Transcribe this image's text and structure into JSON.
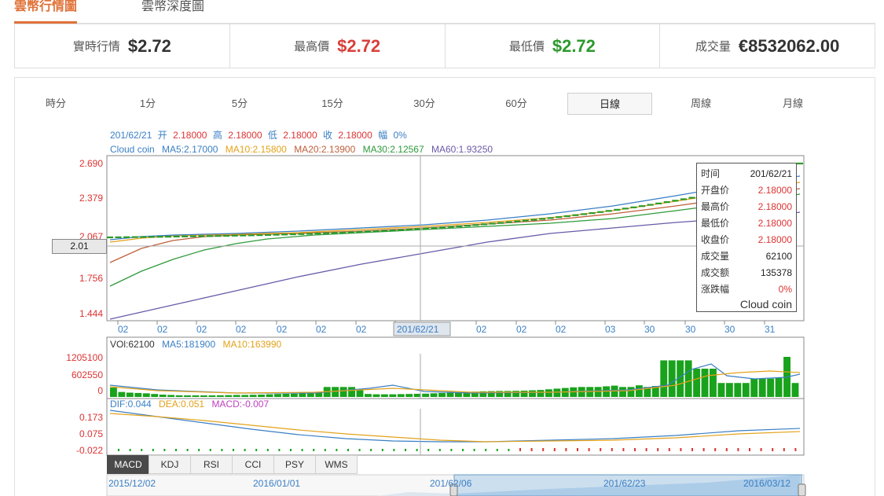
{
  "tabs": [
    {
      "label": "雲幣行情圖",
      "active": true
    },
    {
      "label": "雲幣深度圖",
      "active": false
    }
  ],
  "stats": [
    {
      "label": "實時行情",
      "value": "$2.72",
      "color": "#333333"
    },
    {
      "label": "最高價",
      "value": "$2.72",
      "color": "#d9403a"
    },
    {
      "label": "最低價",
      "value": "$2.72",
      "color": "#2d9a2d"
    },
    {
      "label": "成交量",
      "value": "€8532062.00",
      "color": "#333333"
    }
  ],
  "timeframes": [
    {
      "label": "時分",
      "active": false
    },
    {
      "label": "1分",
      "active": false
    },
    {
      "label": "5分",
      "active": false
    },
    {
      "label": "15分",
      "active": false
    },
    {
      "label": "30分",
      "active": false
    },
    {
      "label": "60分",
      "active": false
    },
    {
      "label": "日線",
      "active": true
    },
    {
      "label": "周線",
      "active": false
    },
    {
      "label": "月線",
      "active": false
    }
  ],
  "ohlc_line": {
    "date": "201/62/21",
    "open_label": "开",
    "open": "2.18000",
    "high_label": "高",
    "high": "2.18000",
    "low_label": "低",
    "low": "2.18000",
    "close_label": "收",
    "close": "2.18000",
    "change_label": "幅",
    "change": "0%"
  },
  "ma_line": {
    "name": "Cloud coin",
    "items": [
      {
        "label": "MA5:2.17000",
        "color": "#3a7fc4"
      },
      {
        "label": "MA10:2.15800",
        "color": "#e3a21a"
      },
      {
        "label": "MA20:2.13900",
        "color": "#c0603a"
      },
      {
        "label": "MA30:2.12567",
        "color": "#2f9a3a"
      },
      {
        "label": "MA60:1.93250",
        "color": "#6a5aa8"
      }
    ]
  },
  "price_axis": [
    "2.690",
    "2.379",
    "2.067",
    "1.756",
    "1.444"
  ],
  "crosshair_price": "2.01",
  "x_ticks": [
    "02",
    "02",
    "02",
    "02",
    "02",
    "02",
    "02",
    "201/62/21",
    "02",
    "02",
    "02",
    "03",
    "30",
    "30",
    "30",
    "31"
  ],
  "tooltip": {
    "rows": [
      {
        "label": "时间",
        "value": "201/62/21",
        "red": false
      },
      {
        "label": "开盘价",
        "value": "2.18000",
        "red": true
      },
      {
        "label": "最高价",
        "value": "2.18000",
        "red": true
      },
      {
        "label": "最低价",
        "value": "2.18000",
        "red": true
      },
      {
        "label": "收盘价",
        "value": "2.18000",
        "red": true
      },
      {
        "label": "成交量",
        "value": "62100",
        "red": false
      },
      {
        "label": "成交额",
        "value": "135378",
        "red": false
      },
      {
        "label": "涨跌幅",
        "value": "0%",
        "red": true
      }
    ],
    "brand": "Cloud coin"
  },
  "volume": {
    "legend": [
      {
        "label": "VOl:62100",
        "color": "#333333"
      },
      {
        "label": "MA5:181900",
        "color": "#3a7fc4"
      },
      {
        "label": "MA10:163990",
        "color": "#e3a21a"
      }
    ],
    "axis": [
      "1205100",
      "602550",
      "0"
    ],
    "max": 1205100,
    "bars": [
      280000,
      150000,
      130000,
      120000,
      110000,
      90000,
      70000,
      60000,
      50000,
      45000,
      40000,
      40000,
      45000,
      50000,
      55000,
      60000,
      60000,
      65000,
      70000,
      80000,
      90000,
      95000,
      100000,
      110000,
      120000,
      130000,
      300000,
      300000,
      300000,
      300000,
      200000,
      90000,
      80000,
      80000,
      80000,
      85000,
      90000,
      95000,
      100000,
      110000,
      120000,
      130000,
      140000,
      150000,
      160000,
      170000,
      175000,
      180000,
      180000,
      185000,
      190000,
      200000,
      210000,
      230000,
      250000,
      270000,
      290000,
      300000,
      300000,
      300000,
      320000,
      340000,
      300000,
      300000,
      350000,
      300000,
      330000,
      1100000,
      1100000,
      1100000,
      1100000,
      850000,
      850000,
      850000,
      420000,
      420000,
      420000,
      420000,
      550000,
      550000,
      550000,
      580000,
      1205100,
      420000
    ]
  },
  "macd": {
    "legend": [
      {
        "label": "DIF:0.044",
        "color": "#3a7fc4"
      },
      {
        "label": "DEA:0.051",
        "color": "#e3a21a"
      },
      {
        "label": "MACD:-0.007",
        "color": "#c040c0"
      }
    ],
    "axis": [
      "0.173",
      "0.075",
      "-0.022"
    ]
  },
  "indicator_tabs": [
    {
      "label": "MACD",
      "active": true
    },
    {
      "label": "KDJ",
      "active": false
    },
    {
      "label": "RSI",
      "active": false
    },
    {
      "label": "CCI",
      "active": false
    },
    {
      "label": "PSY",
      "active": false
    },
    {
      "label": "WMS",
      "active": false
    }
  ],
  "navigator_dates": [
    "2015/12/02",
    "2016/01/01",
    "201/62/06",
    "201/62/23",
    "2016/03/12"
  ]
}
